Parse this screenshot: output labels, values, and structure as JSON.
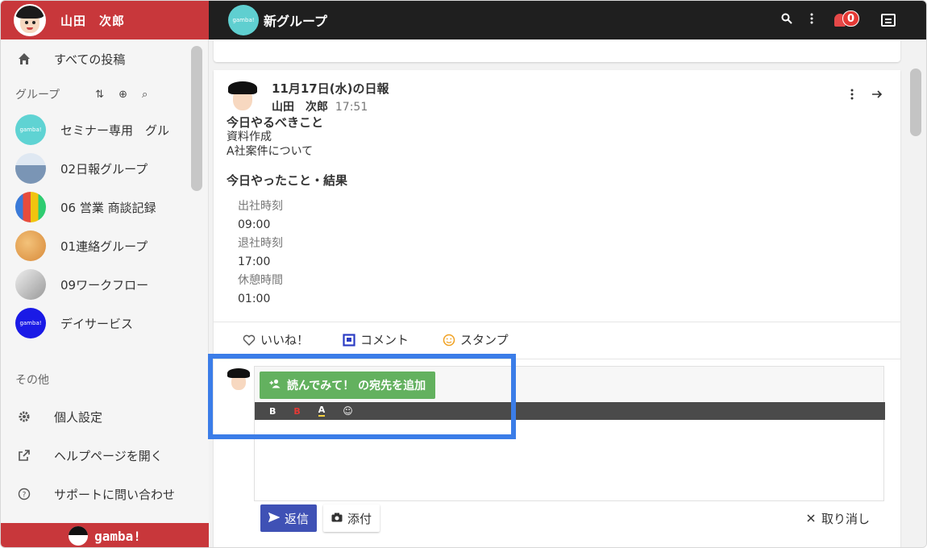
{
  "user": {
    "name": "山田　次郎"
  },
  "sidebar": {
    "all_posts": "すべての投稿",
    "groups_label": "グループ",
    "group_tools": [
      "⇅",
      "⊕",
      "⌕"
    ],
    "groups": [
      {
        "label": "セミナー専用　グル",
        "color": "#5fd3d3",
        "logo": "gamba!"
      },
      {
        "label": "02日報グループ",
        "color": "#7a95b5",
        "logo": ""
      },
      {
        "label": "06 営業 商談記録",
        "color": "#e77a4d",
        "logo": ""
      },
      {
        "label": "01連絡グループ",
        "color": "#e0a25a",
        "logo": ""
      },
      {
        "label": "09ワークフロー",
        "color": "#bdbdbd",
        "logo": ""
      },
      {
        "label": "デイサービス",
        "color": "#1a1ae6",
        "logo": "gamba!"
      }
    ],
    "other_label": "その他",
    "other_items": [
      {
        "label": "個人設定",
        "icon": "gear-icon"
      },
      {
        "label": "ヘルプページを開く",
        "icon": "external-link-icon"
      },
      {
        "label": "サポートに問い合わせ",
        "icon": "help-circle-icon"
      }
    ],
    "footer_brand": "gamba!"
  },
  "topbar": {
    "group_logo": "gamba!",
    "title": "新グループ",
    "notification_count": "0"
  },
  "post": {
    "title": "11月17日(水)の日報",
    "author": "山田　次郎",
    "time": "17:51",
    "todo_heading": "今日やるべきこと",
    "todo_lines": [
      "資料作成",
      "A社案件について"
    ],
    "done_heading": "今日やったこと・結果",
    "fields": [
      {
        "label": "出社時刻",
        "value": "09:00"
      },
      {
        "label": "退社時刻",
        "value": "17:00"
      },
      {
        "label": "休憩時間",
        "value": "01:00"
      }
    ],
    "reactions": {
      "like": "いいね！",
      "comment": "コメント",
      "stamp": "スタンプ"
    }
  },
  "reply": {
    "add_destination": "読んでみて！ の宛先を追加",
    "format_bold": "B",
    "format_red": "B",
    "format_highlight": "A",
    "format_emoji": "☺",
    "send": "返信",
    "attach": "添付",
    "cancel": "取り消し"
  }
}
